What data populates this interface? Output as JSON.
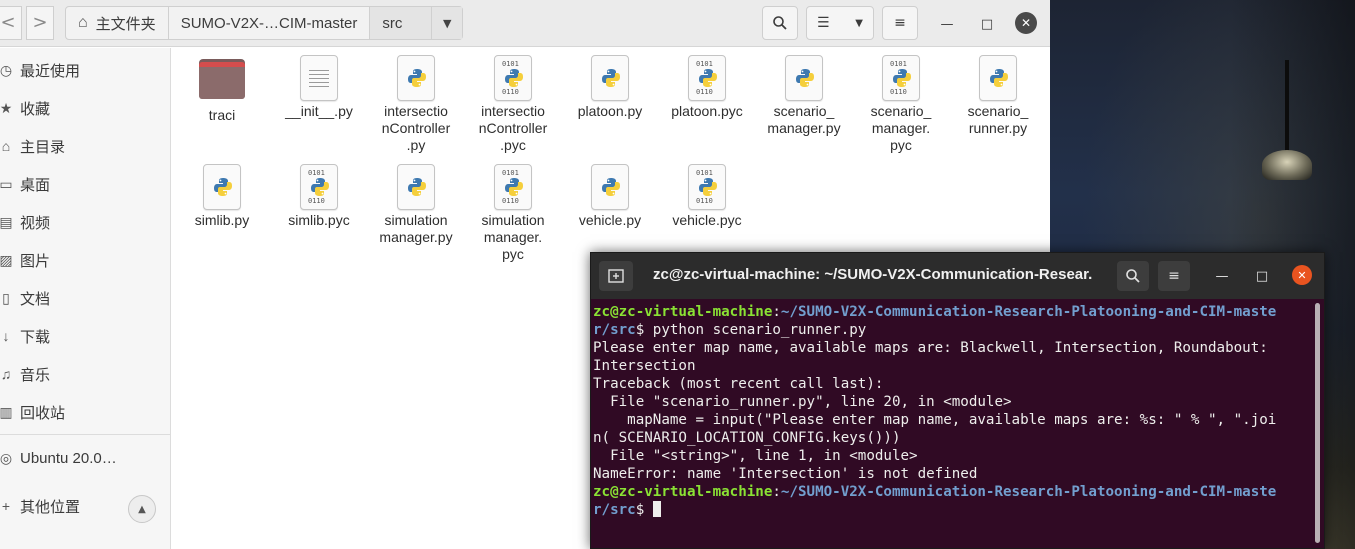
{
  "file_manager": {
    "nav": {
      "back": "<",
      "forward": ">"
    },
    "breadcrumbs": [
      "主文件夹",
      "SUMO-V2X-…CIM-master",
      "src"
    ],
    "sidebar": [
      {
        "label": "最近使用",
        "icon": "clock-icon"
      },
      {
        "label": "收藏",
        "icon": "star-icon"
      },
      {
        "label": "主目录",
        "icon": "home-icon"
      },
      {
        "label": "桌面",
        "icon": "desktop-icon"
      },
      {
        "label": "视频",
        "icon": "video-icon"
      },
      {
        "label": "图片",
        "icon": "picture-icon"
      },
      {
        "label": "文档",
        "icon": "document-icon"
      },
      {
        "label": "下载",
        "icon": "download-icon"
      },
      {
        "label": "音乐",
        "icon": "music-icon"
      },
      {
        "label": "回收站",
        "icon": "trash-icon"
      },
      {
        "label": "Ubuntu 20.0…",
        "icon": "disc-icon"
      },
      {
        "label": "其他位置",
        "icon": "plus-icon"
      }
    ],
    "files": [
      {
        "name": "traci",
        "kind": "folder"
      },
      {
        "name": "__init__.py",
        "kind": "text"
      },
      {
        "name": "intersectionController.py",
        "kind": "python"
      },
      {
        "name": "intersectionController.pyc",
        "kind": "bytecode"
      },
      {
        "name": "platoon.py",
        "kind": "python"
      },
      {
        "name": "platoon.pyc",
        "kind": "bytecode"
      },
      {
        "name": "scenario_manager.py",
        "kind": "python"
      },
      {
        "name": "scenario_manager.pyc",
        "kind": "bytecode"
      },
      {
        "name": "scenario_runner.py",
        "kind": "python"
      },
      {
        "name": "simlib.py",
        "kind": "python"
      },
      {
        "name": "simlib.pyc",
        "kind": "bytecode"
      },
      {
        "name": "simulationmanager.py",
        "kind": "python"
      },
      {
        "name": "simulationmanager.pyc",
        "kind": "bytecode"
      },
      {
        "name": "vehicle.py",
        "kind": "python"
      },
      {
        "name": "vehicle.pyc",
        "kind": "bytecode"
      }
    ],
    "labels_display": [
      "traci",
      "__init__.py",
      "intersectio|nController|.py",
      "intersectio|nController|.pyc",
      "platoon.py",
      "platoon.pyc",
      "scenario_|manager.py",
      "scenario_|manager.|pyc",
      "scenario_|runner.py",
      "simlib.py",
      "simlib.pyc",
      "simulation|manager.py",
      "simulation|manager.|pyc",
      "vehicle.py",
      "vehicle.pyc"
    ],
    "bin_text": {
      "top": "0101",
      "bottom": "0110"
    }
  },
  "terminal": {
    "title": "zc@zc-virtual-machine: ~/SUMO-V2X-Communication-Resear...",
    "new_tab": "+",
    "lines": [
      {
        "parts": [
          {
            "t": "zc@zc-virtual-machine",
            "c": "g"
          },
          {
            "t": ":",
            "c": ""
          },
          {
            "t": "~/SUMO-V2X-Communication-Research-Platooning-and-CIM-maste",
            "c": "b"
          }
        ]
      },
      {
        "parts": [
          {
            "t": "r/src",
            "c": "b"
          },
          {
            "t": "$ python scenario_runner.py",
            "c": ""
          }
        ]
      },
      {
        "parts": [
          {
            "t": "Please enter map name, available maps are: Blackwell, Intersection, Roundabout:",
            "c": ""
          }
        ]
      },
      {
        "parts": [
          {
            "t": "Intersection",
            "c": ""
          }
        ]
      },
      {
        "parts": [
          {
            "t": "Traceback (most recent call last):",
            "c": ""
          }
        ]
      },
      {
        "parts": [
          {
            "t": "  File \"scenario_runner.py\", line 20, in <module>",
            "c": ""
          }
        ]
      },
      {
        "parts": [
          {
            "t": "    mapName = input(\"Please enter map name, available maps are: %s: \" % \", \".joi",
            "c": ""
          }
        ]
      },
      {
        "parts": [
          {
            "t": "n( SCENARIO_LOCATION_CONFIG.keys()))",
            "c": ""
          }
        ]
      },
      {
        "parts": [
          {
            "t": "  File \"<string>\", line 1, in <module>",
            "c": ""
          }
        ]
      },
      {
        "parts": [
          {
            "t": "NameError: name 'Intersection' is not defined",
            "c": ""
          }
        ]
      },
      {
        "parts": [
          {
            "t": "zc@zc-virtual-machine",
            "c": "g"
          },
          {
            "t": ":",
            "c": ""
          },
          {
            "t": "~/SUMO-V2X-Communication-Research-Platooning-and-CIM-maste",
            "c": "b"
          }
        ]
      },
      {
        "parts": [
          {
            "t": "r/src",
            "c": "b"
          },
          {
            "t": "$ ",
            "c": ""
          }
        ],
        "cursor": true
      }
    ]
  },
  "colors": {
    "terminal_bg": "#300a24",
    "prompt_user": "#8ae234",
    "prompt_path": "#729fcf",
    "close_accent": "#e95420"
  }
}
